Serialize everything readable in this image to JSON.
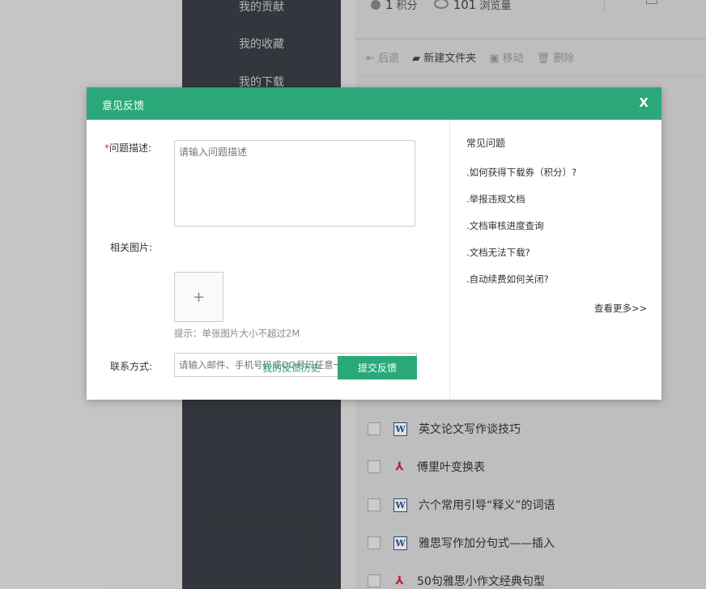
{
  "background": {
    "sidebar_items": [
      "我的贡献",
      "我的收藏",
      "我的下载"
    ],
    "stats": {
      "points_value": "1",
      "points_label": "积分",
      "views_value": "101",
      "views_label": "浏览量"
    },
    "toolbar": {
      "back": "后退",
      "new_folder": "新建文件夹",
      "move": "移动",
      "delete": "删除"
    },
    "documents": [
      {
        "type": "word",
        "title": "英文论文写作谈技巧"
      },
      {
        "type": "pdf",
        "title": "傅里叶变换表"
      },
      {
        "type": "word",
        "title": "六个常用引导“释义”的词语"
      },
      {
        "type": "word",
        "title": "雅思写作加分句式——插入"
      },
      {
        "type": "pdf",
        "title": "50句雅思小作文经典句型"
      }
    ]
  },
  "modal": {
    "title": "意见反馈",
    "close": "X",
    "form": {
      "description_label": "问题描述:",
      "description_required_mark": "*",
      "description_placeholder": "请输入问题描述",
      "image_label": "相关图片:",
      "upload_symbol": "+",
      "image_hint": "提示：单张图片大小不超过2M",
      "contact_label": "联系方式:",
      "contact_placeholder": "请输入邮件、手机号码或QQ号码任意一种联系方式",
      "history_link": "我的反馈历史",
      "submit": "提交反馈"
    },
    "faq": {
      "title": "常见问题",
      "items": [
        ".如何获得下载券（积分）?",
        ".举报违规文档",
        ".文档审核进度查询",
        ".文档无法下载?",
        ".自动续费如何关闭?"
      ],
      "more": "查看更多>>"
    }
  },
  "colors": {
    "brand": "#2aa87a",
    "sidebar": "#3b3e45",
    "required": "#e33333"
  }
}
